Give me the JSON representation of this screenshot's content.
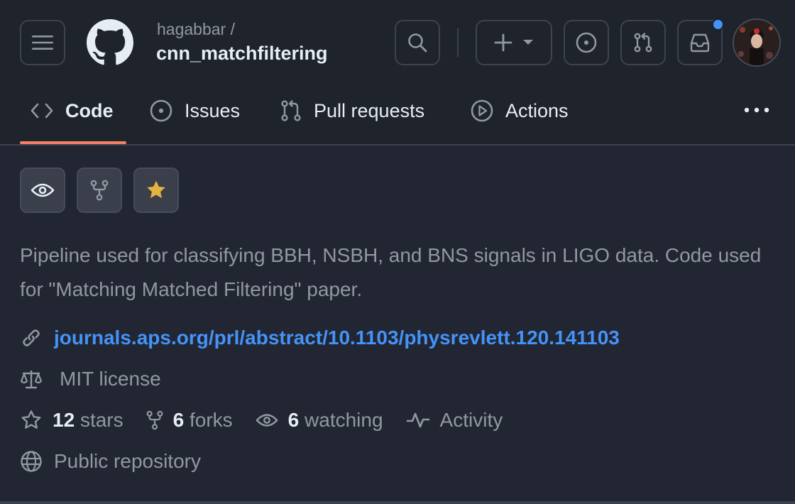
{
  "header": {
    "owner": "hagabbar /",
    "repo_name": "cnn_matchfiltering"
  },
  "tabs": [
    {
      "label": "Code",
      "icon": "code-icon",
      "active": true
    },
    {
      "label": "Issues",
      "icon": "issue-opened-icon"
    },
    {
      "label": "Pull requests",
      "icon": "git-pull-request-icon"
    },
    {
      "label": "Actions",
      "icon": "play-icon"
    }
  ],
  "description": "Pipeline used for classifying BBH, NSBH, and BNS signals in LIGO data. Code used for \"Matching Matched Filtering\" paper.",
  "link": "journals.aps.org/prl/abstract/10.1103/physrevlett.120.141103",
  "license": "MIT license",
  "stats": {
    "stars_count": "12",
    "stars_label": "stars",
    "forks_count": "6",
    "forks_label": "forks",
    "watching_count": "6",
    "watching_label": "watching",
    "activity_label": "Activity"
  },
  "visibility": "Public repository",
  "colors": {
    "accent_link": "#4493f8",
    "tab_underline": "#f78166",
    "star": "#e3b341",
    "notification": "#4493f8"
  }
}
